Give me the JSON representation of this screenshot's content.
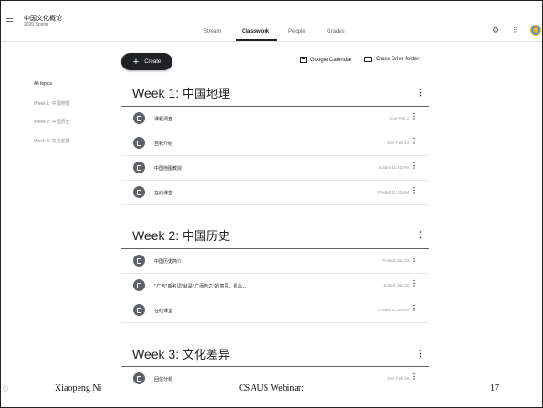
{
  "header": {
    "class_title": "中国文化概论",
    "class_subtitle": "2020 Spring",
    "tabs": [
      {
        "label": "Stream"
      },
      {
        "label": "Classwork"
      },
      {
        "label": "People"
      },
      {
        "label": "Grades"
      }
    ],
    "active_tab": "Classwork"
  },
  "toolbar": {
    "create_label": "Create",
    "calendar_label": "Google Calendar",
    "drive_label": "Class Drive folder"
  },
  "sidebar": {
    "items": [
      {
        "label": "All topics"
      },
      {
        "label": "Week 1: 中国地理"
      },
      {
        "label": "Week 2: 中国历史"
      },
      {
        "label": "Week 3: 文化差异"
      }
    ]
  },
  "sections": [
    {
      "title_prefix": "Week 1: ",
      "title_cn": "中国地理",
      "items": [
        {
          "title": "课程调查",
          "meta": "Due Feb 2"
        },
        {
          "title": "自我介绍",
          "meta": "Due Feb 14"
        },
        {
          "title": "中国地图教授",
          "meta": "Edited 11:43 AM"
        },
        {
          "title": "在线课堂",
          "meta": "Posted 11:43 AM"
        }
      ]
    },
    {
      "title_prefix": "Week 2: ",
      "title_cn": "中国历史",
      "items": [
        {
          "title": "中国历史简介",
          "meta": "Posted Jan 28"
        },
        {
          "title": "\"广告\"新名词\"就是\"广而告之\"的意思，那么...",
          "meta": "Edited Jan 28"
        },
        {
          "title": "在线课堂",
          "meta": "Posted 11:44 AM"
        }
      ]
    },
    {
      "title_prefix": "Week 3: ",
      "title_cn": "文化差异",
      "items": [
        {
          "title": "回信分析",
          "meta": "Due Feb 16"
        }
      ]
    }
  ],
  "footer": {
    "author": "Xiaopeng Ni",
    "event": "CSAUS Webinar:",
    "page_number": "17"
  }
}
